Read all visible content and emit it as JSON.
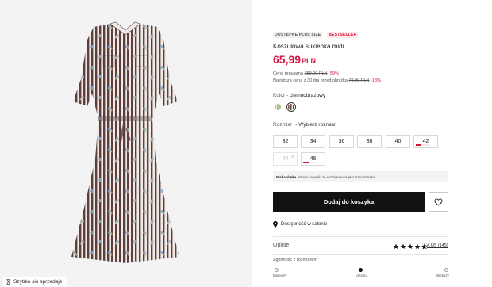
{
  "image_panel": {
    "badge_text": "Szybko się sprzedaje!",
    "badge_icon": "hourglass-icon"
  },
  "product": {
    "tags": [
      "DOSTĘPNE PLUS SIZE",
      "BESTSELLER"
    ],
    "title": "Koszulowa sukienka midi",
    "price": "65,99",
    "currency": "PLN",
    "regular_label": "Cena regularna",
    "regular_price": "159,99 PLN",
    "regular_discount": "-59%",
    "lowest_label": "Najniższa cena z 30 dni przed obniżką",
    "lowest_price": "79,99 PLN",
    "lowest_discount": "-18%"
  },
  "color": {
    "label": "Kolor",
    "value": "ciemnobrązowy",
    "options": [
      "green-stripe",
      "brown-stripe"
    ],
    "selected": "brown-stripe"
  },
  "sizes": {
    "label": "Rozmiar",
    "placeholder": "Wybierz rozmiar",
    "options": [
      {
        "label": "32",
        "state": "available"
      },
      {
        "label": "34",
        "state": "available"
      },
      {
        "label": "36",
        "state": "available"
      },
      {
        "label": "38",
        "state": "available"
      },
      {
        "label": "40",
        "state": "available"
      },
      {
        "label": "42",
        "state": "low-stock"
      },
      {
        "label": "44",
        "state": "out-of-stock"
      },
      {
        "label": "46",
        "state": "low-stock"
      }
    ]
  },
  "notice": {
    "title": "Wskazówka",
    "text": "Klienci ocenili, że rozmiarówka jest standardowa."
  },
  "actions": {
    "add_to_cart": "Dodaj do koszyka",
    "favorite_icon": "heart-icon"
  },
  "store": {
    "text": "Dostępność w salonie",
    "icon": "location-pin-icon"
  },
  "reviews": {
    "label": "Opinie",
    "rating": 4.6,
    "rating_text": "4,6/5 (145)"
  },
  "fit": {
    "label": "Zgodność z rozmiarem",
    "scale": [
      "Mniejszy",
      "Idealny",
      "Większy"
    ],
    "value": "Idealny"
  },
  "colors": {
    "accent": "#d4153c",
    "button": "#111111"
  }
}
